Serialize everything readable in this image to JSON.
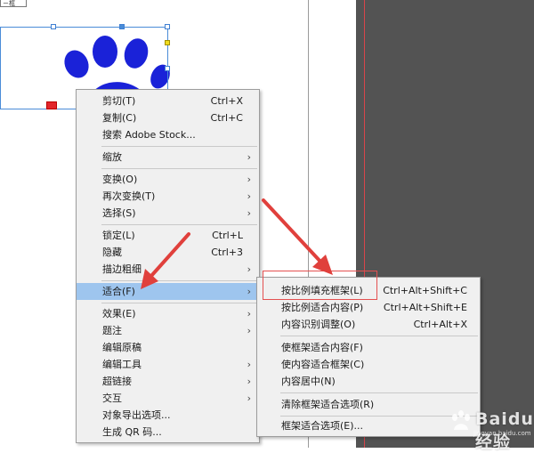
{
  "canvas": {
    "top_tab_label": "ㄧ框"
  },
  "context_menu": {
    "items": [
      {
        "label": "剪切(T)",
        "shortcut": "Ctrl+X"
      },
      {
        "label": "复制(C)",
        "shortcut": "Ctrl+C"
      },
      {
        "label": "搜索 Adobe Stock...",
        "shortcut": ""
      },
      {
        "label": "缩放",
        "shortcut": ""
      },
      {
        "label": "变换(O)",
        "shortcut": ""
      },
      {
        "label": "再次变换(T)",
        "shortcut": ""
      },
      {
        "label": "选择(S)",
        "shortcut": ""
      },
      {
        "label": "锁定(L)",
        "shortcut": "Ctrl+L"
      },
      {
        "label": "隐藏",
        "shortcut": "Ctrl+3"
      },
      {
        "label": "描边粗细",
        "shortcut": ""
      },
      {
        "label": "适合(F)",
        "shortcut": ""
      },
      {
        "label": "效果(E)",
        "shortcut": ""
      },
      {
        "label": "题注",
        "shortcut": ""
      },
      {
        "label": "编辑原稿",
        "shortcut": ""
      },
      {
        "label": "编辑工具",
        "shortcut": ""
      },
      {
        "label": "超链接",
        "shortcut": ""
      },
      {
        "label": "交互",
        "shortcut": ""
      },
      {
        "label": "对象导出选项...",
        "shortcut": ""
      },
      {
        "label": "生成 QR 码...",
        "shortcut": ""
      }
    ]
  },
  "submenu": {
    "items": [
      {
        "label": "按比例填充框架(L)",
        "shortcut": "Ctrl+Alt+Shift+C"
      },
      {
        "label": "按比例适合内容(P)",
        "shortcut": "Ctrl+Alt+Shift+E"
      },
      {
        "label": "内容识别调整(O)",
        "shortcut": "Ctrl+Alt+X"
      },
      {
        "label": "使框架适合内容(F)",
        "shortcut": ""
      },
      {
        "label": "使内容适合框架(C)",
        "shortcut": ""
      },
      {
        "label": "内容居中(N)",
        "shortcut": ""
      },
      {
        "label": "清除框架适合选项(R)",
        "shortcut": ""
      },
      {
        "label": "框架适合选项(E)...",
        "shortcut": ""
      }
    ]
  },
  "submenu_arrow_glyph": "›",
  "colors": {
    "highlight": "#9ec5ee",
    "annotation_red": "#e0403c",
    "paw_blue": "#1a22d8",
    "pasteboard": "#535353"
  },
  "watermark": {
    "text": "Baidu经验",
    "sub": "jingyan.baidu.com"
  }
}
